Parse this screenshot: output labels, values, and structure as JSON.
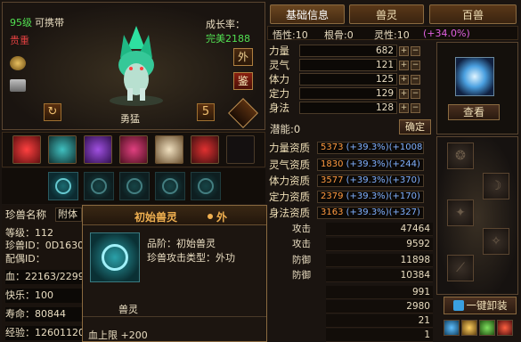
{
  "pet": {
    "level_label": "95级",
    "portable_label": "可携带",
    "rarity": "贵重",
    "growth_label": "成长率：",
    "growth_value": "完美2188",
    "trait": "勇猛",
    "outer_btn": "外",
    "appraise_btn": "鉴",
    "page_num": "5"
  },
  "tabs": [
    "基础信息",
    "兽灵",
    "百兽"
  ],
  "header_stats": {
    "comprehension": "悟性:10",
    "root_bone": "根骨:0",
    "spirit": "灵性:10",
    "spirit_bonus": "(+34.0%)"
  },
  "base_stats": [
    {
      "label": "力量",
      "value": "682"
    },
    {
      "label": "灵气",
      "value": "121"
    },
    {
      "label": "体力",
      "value": "125"
    },
    {
      "label": "定力",
      "value": "129"
    },
    {
      "label": "身法",
      "value": "128"
    }
  ],
  "potential_label": "潜能:0",
  "confirm_btn": "确定",
  "aptitudes": [
    {
      "label": "力量资质",
      "base": "5373",
      "pct": "(+39.3%)",
      "bonus": "(+1008)"
    },
    {
      "label": "灵气资质",
      "base": "1830",
      "pct": "(+39.3%)",
      "bonus": "(+244)"
    },
    {
      "label": "体力资质",
      "base": "3577",
      "pct": "(+39.3%)",
      "bonus": "(+370)"
    },
    {
      "label": "定力资质",
      "base": "2379",
      "pct": "(+39.3%)",
      "bonus": "(+170)"
    },
    {
      "label": "身法资质",
      "base": "3163",
      "pct": "(+39.3%)",
      "bonus": "(+327)"
    }
  ],
  "fight_stats": [
    {
      "label": "攻击",
      "value": "47464"
    },
    {
      "label": "攻击",
      "value": "9592"
    },
    {
      "label": "防御",
      "value": "11898"
    },
    {
      "label": "防御",
      "value": "10384"
    },
    {
      "label": "",
      "value": "991"
    },
    {
      "label": "",
      "value": "2980"
    },
    {
      "label": "",
      "value": "21"
    },
    {
      "label": "",
      "value": "1"
    }
  ],
  "view_btn": "查看",
  "one_key_btn": "一键卸装",
  "left_info": {
    "name_label": "珍兽名称",
    "name_value": "附体",
    "level": "等级：112",
    "pet_id": "珍兽ID：0D1630",
    "spouse_id": "配偶ID：",
    "hp": "血：22163/2299",
    "happy": "快乐：100",
    "life": "寿命：80844",
    "exp": "经验：12601120"
  },
  "tooltip": {
    "title": "初始兽灵",
    "title_suffix": "外",
    "grade": "品阶：初始兽灵",
    "attack_type": "珍兽攻击类型：外功",
    "caption": "兽灵",
    "stat": "血上限 +200"
  }
}
